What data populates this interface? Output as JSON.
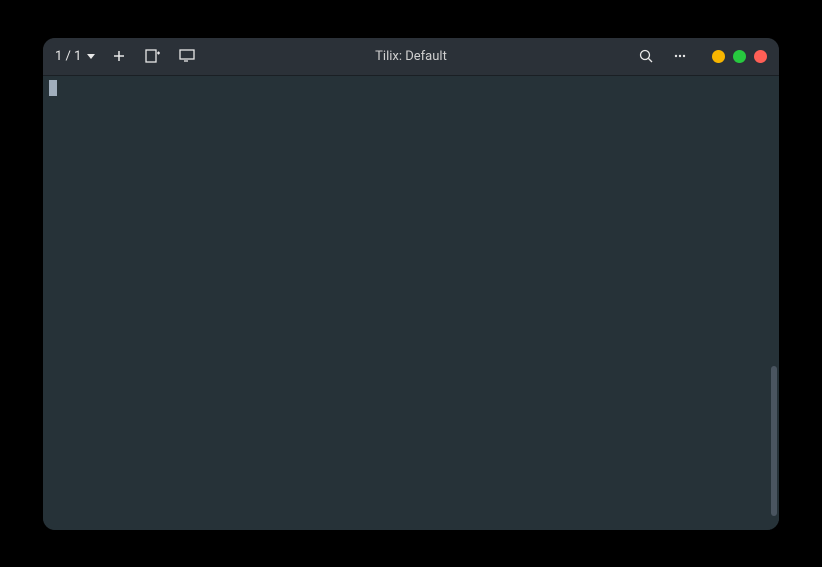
{
  "titlebar": {
    "session_counter": "1 / 1",
    "title": "Tilix: Default"
  },
  "terminal": {
    "content": ""
  },
  "colors": {
    "titlebar_bg": "#2b3138",
    "terminal_bg": "#263238",
    "minimize": "#f7b500",
    "maximize": "#27c93f",
    "close": "#ff5f56"
  }
}
